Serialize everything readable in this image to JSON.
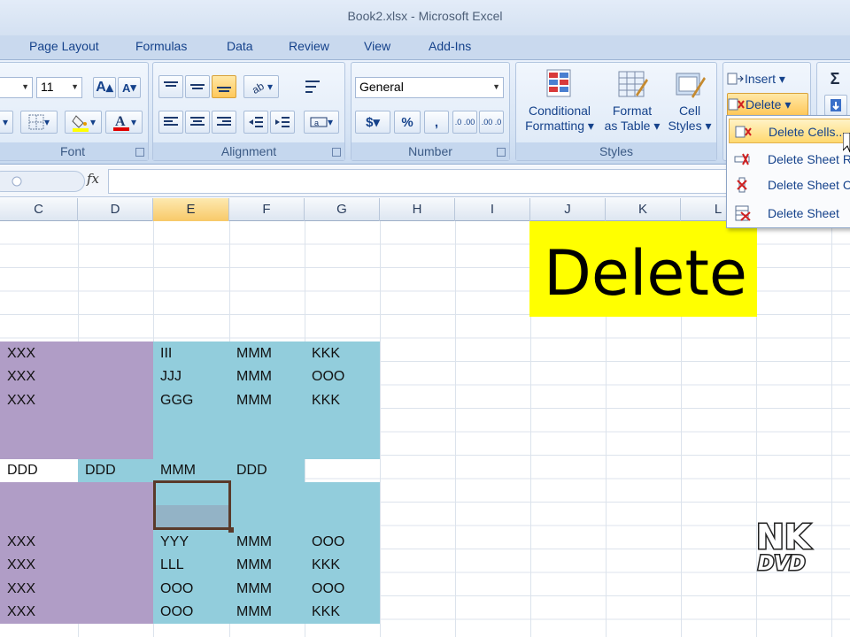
{
  "window": {
    "title": "Book2.xlsx - Microsoft Excel"
  },
  "ribbon_tabs": [
    "Page Layout",
    "Formulas",
    "Data",
    "Review",
    "View",
    "Add-Ins"
  ],
  "font_group": {
    "size": "11",
    "label": "Font",
    "grow_label": "A",
    "shrink_label": "A",
    "color_label": "A"
  },
  "alignment_group": {
    "label": "Alignment"
  },
  "number_group": {
    "format": "General",
    "label": "Number",
    "currency": "$",
    "percent": "%",
    "comma": ",",
    "inc_decimal": ".0 .00",
    "dec_decimal": ".00 .0"
  },
  "styles_group": {
    "label": "Styles",
    "conditional_line1": "Conditional",
    "conditional_line2": "Formatting",
    "format_table_line1": "Format",
    "format_table_line2": "as Table",
    "cell_styles_line1": "Cell",
    "cell_styles_line2": "Styles"
  },
  "cells_group": {
    "insert": "Insert",
    "delete": "Delete",
    "sum_icon": "Σ"
  },
  "delete_menu": [
    "Delete Cells...",
    "Delete Sheet R",
    "Delete Sheet C",
    "Delete Sheet"
  ],
  "formula_bar": {
    "fx": "fx",
    "value": ""
  },
  "columns": [
    "C",
    "D",
    "E",
    "F",
    "G",
    "H",
    "I",
    "J",
    "K",
    "L"
  ],
  "selected_column": "E",
  "overlay_text": "Delete",
  "logo": "NK DVD",
  "cells": {
    "r1": [
      "XXX",
      "III",
      "MMM",
      "KKK"
    ],
    "r2": [
      "XXX",
      "JJJ",
      "MMM",
      "OOO"
    ],
    "r3": [
      "XXX",
      "GGG",
      "MMM",
      "KKK"
    ],
    "r4": [
      "DDD",
      "DDD",
      "MMM",
      "DDD"
    ],
    "r5": [
      "XXX",
      "YYY",
      "MMM",
      "OOO"
    ],
    "r6": [
      "XXX",
      "LLL",
      "MMM",
      "KKK"
    ],
    "r7": [
      "XXX",
      "OOO",
      "MMM",
      "OOO"
    ],
    "r8": [
      "XXX",
      "OOO",
      "MMM",
      "KKK"
    ]
  },
  "colors": {
    "purple": "#b09dc6",
    "cyan": "#92cddc",
    "yellow": "#ffff00",
    "selection": "#93b3c6"
  }
}
